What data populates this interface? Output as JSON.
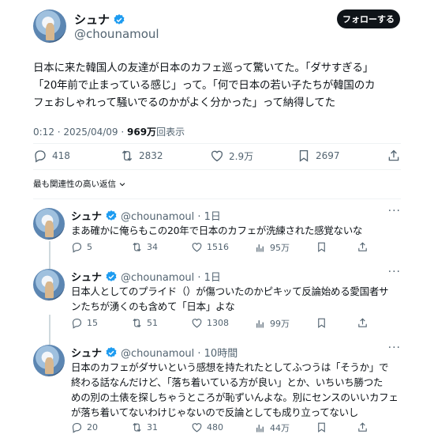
{
  "colors": {
    "text": "#0f1419",
    "muted": "#536471",
    "verified": "#1d9bf0",
    "divider": "#eff3f4"
  },
  "main": {
    "name": "シュナ",
    "handle": "@chounamoul",
    "follow_label": "フォローする",
    "text_lines": [
      "日本に来た韓国人の友達が日本のカフェ巡って驚いてた。「ダサすぎる」",
      "「20年前で止まっている感じ」って。「何で日本の若い子たちが韓国のカ",
      "フェおしゃれって騒いでるのかがよく分かった」って納得してた"
    ],
    "time": "0:12 · 2025/04/09 · ",
    "views_count": "969万",
    "views_label": "回表示",
    "actions": {
      "replies": "418",
      "reposts": "2832",
      "likes": "2.9万",
      "bookmarks": "2697"
    }
  },
  "sort_label": "最も関連性の高い返信",
  "replies": [
    {
      "name": "シュナ",
      "handle": "@chounamoul · 1日",
      "text_lines": [
        "まあ確かに俺らもこの20年で日本のカフェが洗練された感覚ないな"
      ],
      "actions": {
        "replies": "5",
        "reposts": "34",
        "likes": "1516",
        "views": "95万"
      }
    },
    {
      "name": "シュナ",
      "handle": "@chounamoul · 1日",
      "text_lines": [
        "日本人としてのプライド（）が傷ついたのかピキッて反論始める愛国者サ",
        "ンたちが湧くのも含めて「日本」よな"
      ],
      "actions": {
        "replies": "15",
        "reposts": "51",
        "likes": "1308",
        "views": "99万"
      }
    },
    {
      "name": "シュナ",
      "handle": "@chounamoul · 10時間",
      "text_lines": [
        "日本のカフェがダサいという感想を持たれたとしてふつうは「そうか」で",
        "終わる話なんだけど、「落ち着いている方が良い」とか、いちいち勝つた",
        "めの別の土俵を探しちゃうところが恥ずいんよな。別にセンスのいいカフェ",
        "が落ち着いてないわけじゃないので反論としても成り立ってないし"
      ],
      "actions": {
        "replies": "20",
        "reposts": "31",
        "likes": "480",
        "views": "44万"
      }
    }
  ]
}
